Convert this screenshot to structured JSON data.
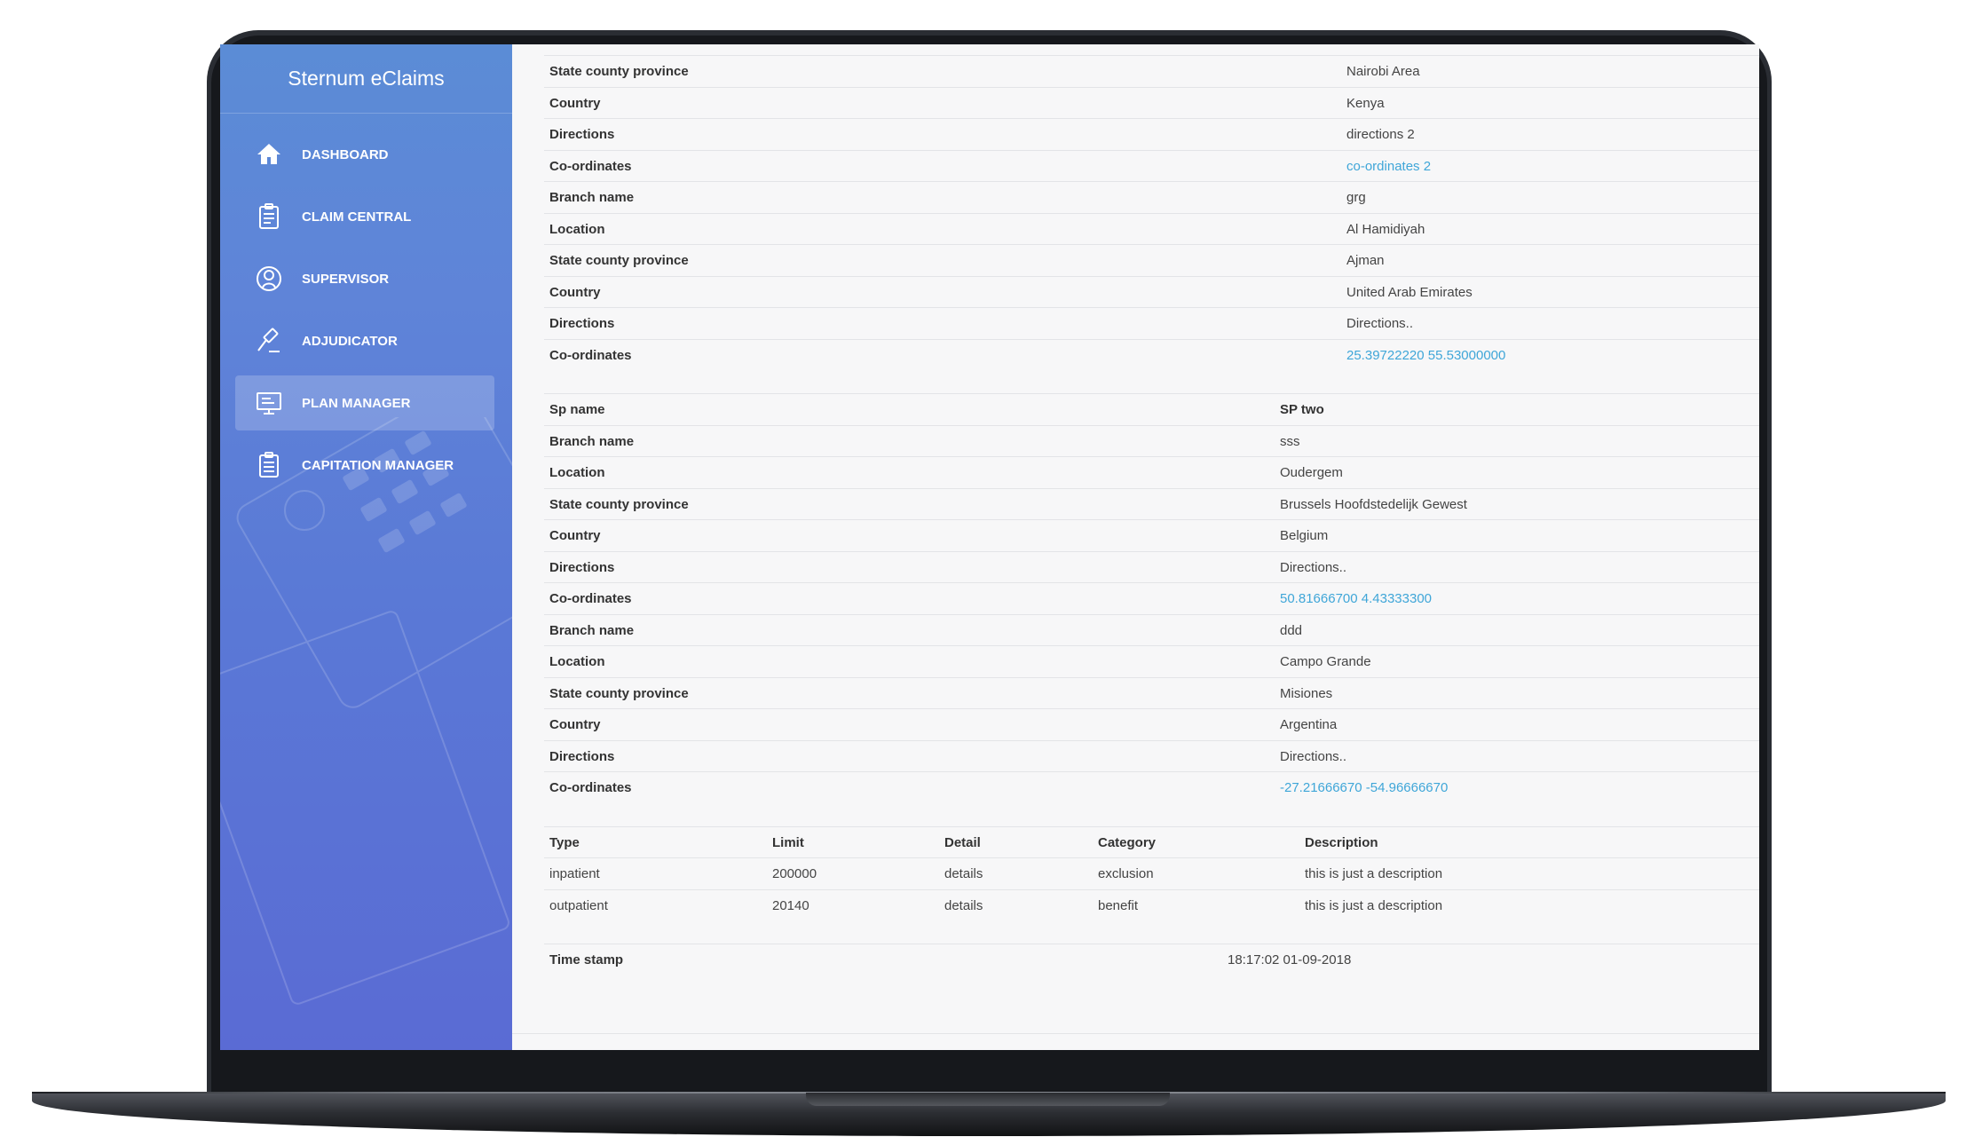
{
  "app": {
    "title": "Sternum eClaims"
  },
  "sidebar": {
    "items": [
      {
        "label": "DASHBOARD",
        "icon": "home-icon"
      },
      {
        "label": "CLAIM CENTRAL",
        "icon": "clipboard-icon"
      },
      {
        "label": "SUPERVISOR",
        "icon": "user-circle-icon"
      },
      {
        "label": "ADJUDICATOR",
        "icon": "gavel-icon"
      },
      {
        "label": "PLAN MANAGER",
        "icon": "presentation-board-icon",
        "active": true
      },
      {
        "label": "CAPITATION MANAGER",
        "icon": "clipboard-list-icon"
      }
    ]
  },
  "details": {
    "block1": [
      {
        "k": "State county province",
        "v": "Nairobi Area"
      },
      {
        "k": "Country",
        "v": "Kenya"
      },
      {
        "k": "Directions",
        "v": "directions 2"
      },
      {
        "k": "Co-ordinates",
        "v": "co-ordinates 2"
      },
      {
        "k": "Branch name",
        "v": "grg"
      },
      {
        "k": "Location",
        "v": "Al Hamidiyah"
      },
      {
        "k": "State county province",
        "v": "Ajman"
      },
      {
        "k": "Country",
        "v": "United Arab Emirates"
      },
      {
        "k": "Directions",
        "v": "Directions.."
      },
      {
        "k": "Co-ordinates",
        "v": "25.39722220 55.53000000"
      }
    ],
    "block2": [
      {
        "k": "Sp name",
        "v": "SP two"
      },
      {
        "k": "Branch name",
        "v": "sss"
      },
      {
        "k": "Location",
        "v": "Oudergem"
      },
      {
        "k": "State county province",
        "v": "Brussels Hoofdstedelijk Gewest"
      },
      {
        "k": "Country",
        "v": "Belgium"
      },
      {
        "k": "Directions",
        "v": "Directions.."
      },
      {
        "k": "Co-ordinates",
        "v": "50.81666700 4.43333300"
      },
      {
        "k": "Branch name",
        "v": "ddd"
      },
      {
        "k": "Location",
        "v": "Campo Grande"
      },
      {
        "k": "State county province",
        "v": "Misiones"
      },
      {
        "k": "Country",
        "v": "Argentina"
      },
      {
        "k": "Directions",
        "v": "Directions.."
      },
      {
        "k": "Co-ordinates",
        "v": "-27.21666670 -54.96666670"
      }
    ]
  },
  "benefits": {
    "headers": [
      "Type",
      "Limit",
      "Detail",
      "Category",
      "Description"
    ],
    "rows": [
      [
        "inpatient",
        "200000",
        "details",
        "exclusion",
        "this is just a description"
      ],
      [
        "outpatient",
        "20140",
        "details",
        "benefit",
        "this is just a description"
      ]
    ]
  },
  "timestamp": {
    "label": "Time stamp",
    "value": "18:17:02 01-09-2018"
  },
  "colors": {
    "sidebar_top": "#5b8cd6",
    "sidebar_bottom": "#5a6bd4",
    "link": "#3fa6d8",
    "content_bg": "#f7f7f8"
  }
}
